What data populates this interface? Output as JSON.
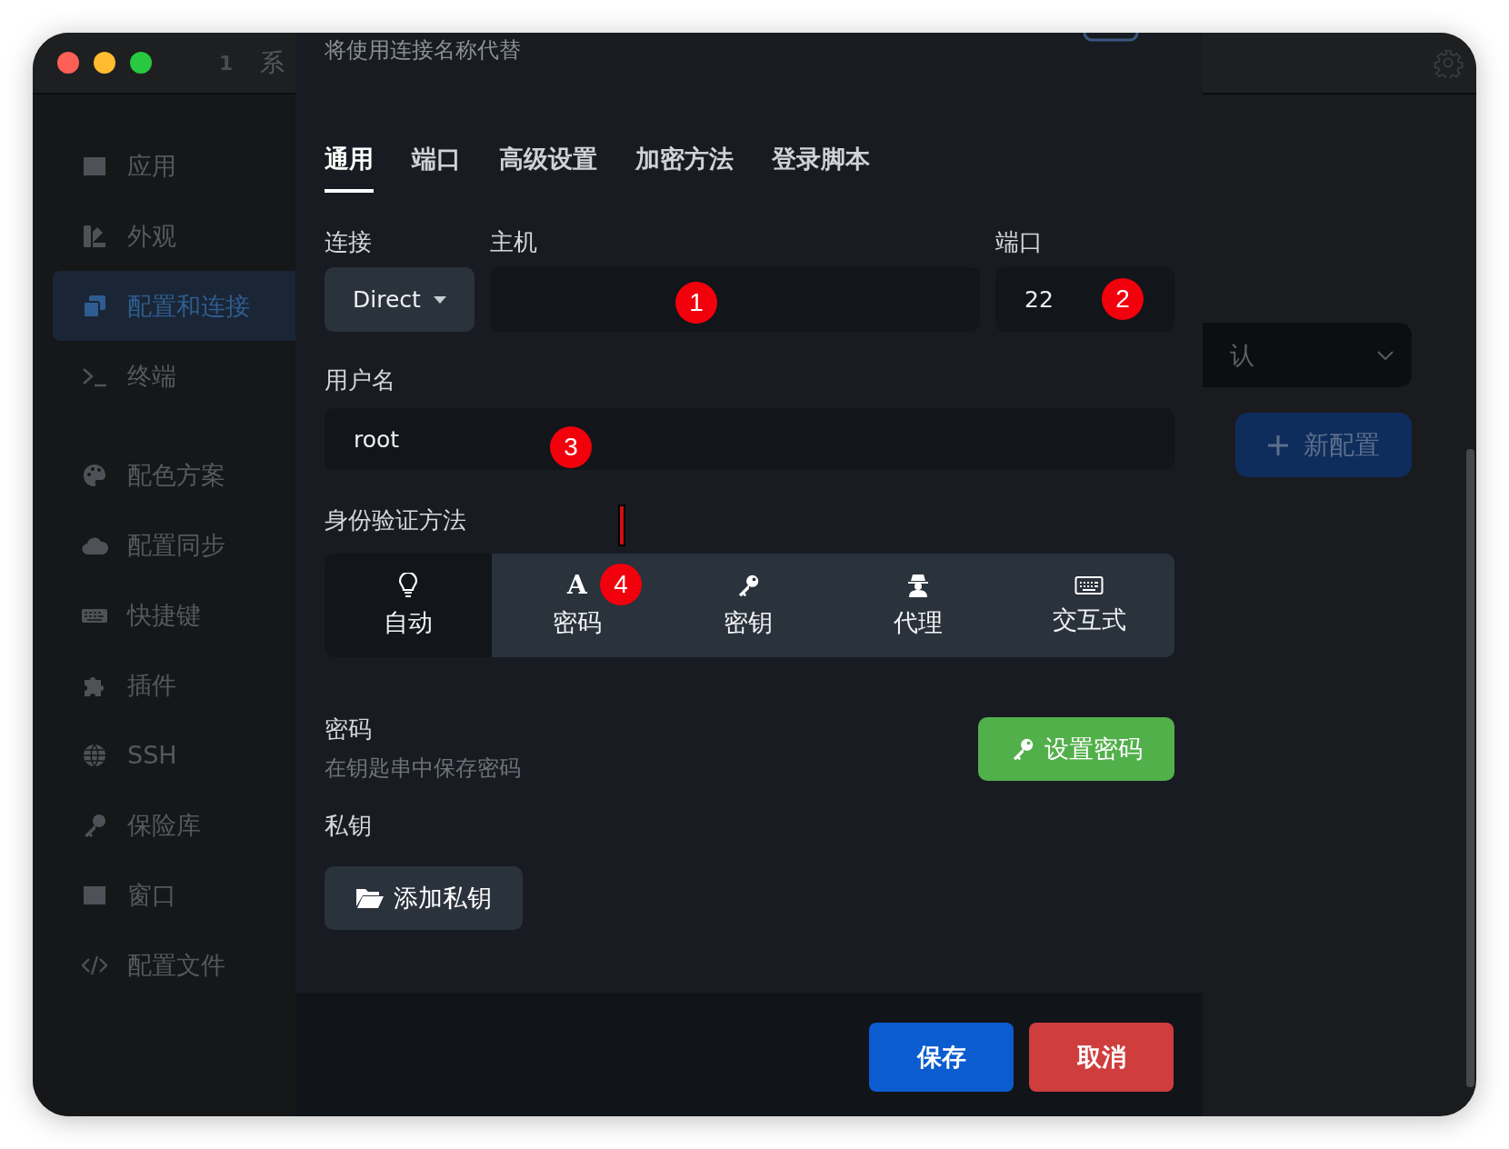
{
  "titlebar": {
    "tab_number": "1",
    "tab_title": "系"
  },
  "sidebar": {
    "groups": [
      {
        "items": [
          {
            "label": "应用",
            "selected": false
          },
          {
            "label": "外观",
            "selected": false
          },
          {
            "label": "配置和连接",
            "selected": true
          },
          {
            "label": "终端",
            "selected": false
          }
        ]
      },
      {
        "items": [
          {
            "label": "配色方案",
            "selected": false
          },
          {
            "label": "配置同步",
            "selected": false
          },
          {
            "label": "快捷键",
            "selected": false
          },
          {
            "label": "插件",
            "selected": false
          },
          {
            "label": "SSH",
            "selected": false
          },
          {
            "label": "保险库",
            "selected": false
          },
          {
            "label": "窗口",
            "selected": false
          },
          {
            "label": "配置文件",
            "selected": false
          }
        ]
      }
    ]
  },
  "main": {
    "select_value": "认",
    "new_button": "新配置"
  },
  "dialog": {
    "hint": "将使用连接名称代替",
    "tabs": [
      {
        "label": "通用",
        "selected": true
      },
      {
        "label": "端口",
        "selected": false
      },
      {
        "label": "高级设置",
        "selected": false
      },
      {
        "label": "加密方法",
        "selected": false
      },
      {
        "label": "登录脚本",
        "selected": false
      }
    ],
    "connection": {
      "label": "连接",
      "value": "Direct"
    },
    "host": {
      "label": "主机"
    },
    "port": {
      "label": "端口",
      "value": "22"
    },
    "username": {
      "label": "用户名",
      "value": "root"
    },
    "auth": {
      "label": "身份验证方法",
      "options": [
        {
          "label": "自动",
          "selected": true
        },
        {
          "label": "密码",
          "glyph": "A",
          "selected": false
        },
        {
          "label": "密钥",
          "selected": false
        },
        {
          "label": "代理",
          "selected": false
        },
        {
          "label": "交互式",
          "selected": false
        }
      ]
    },
    "password": {
      "label": "密码",
      "hint": "在钥匙串中保存密码",
      "button": "设置密码"
    },
    "private_key": {
      "label": "私钥",
      "button": "添加私钥"
    },
    "footer": {
      "save": "保存",
      "cancel": "取消"
    }
  },
  "annotations": [
    {
      "label": "1"
    },
    {
      "label": "2"
    },
    {
      "label": "3"
    },
    {
      "label": "4"
    }
  ]
}
